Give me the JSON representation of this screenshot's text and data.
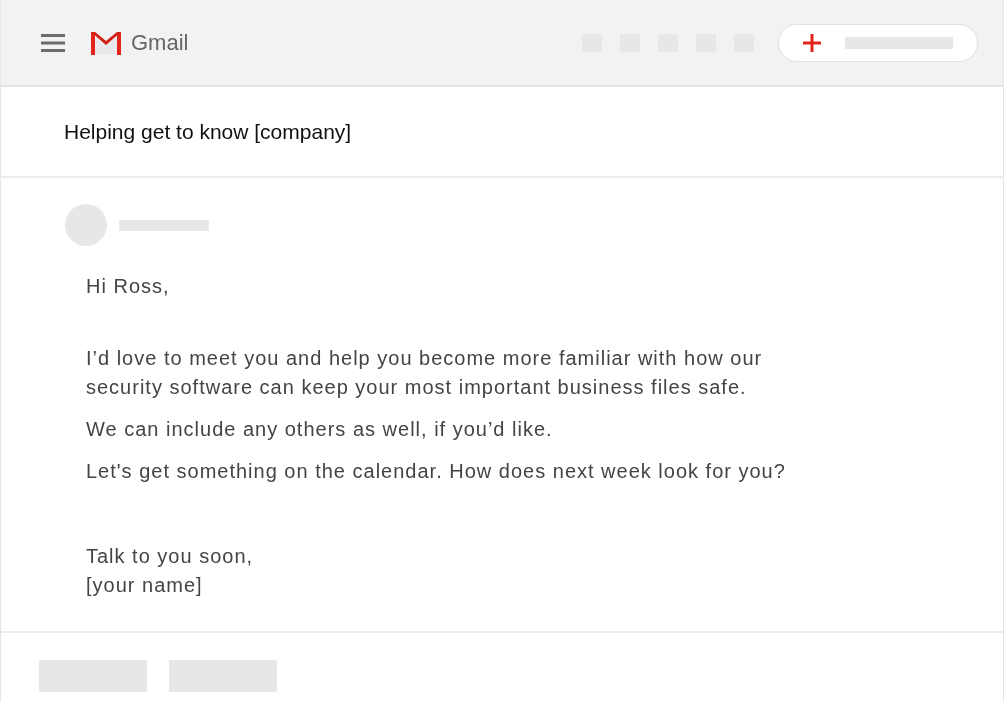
{
  "app": {
    "name": "Gmail"
  },
  "email": {
    "subject": "Helping get to know [company]",
    "paragraphs": [
      {
        "kind": "greeting",
        "lines": [
          "Hi Ross,"
        ]
      },
      {
        "kind": "body",
        "lines": [
          "I’d love to meet you and help you become more familiar with how our",
          "security software can keep your most important business files safe."
        ]
      },
      {
        "kind": "body",
        "lines": [
          "We can include any others as well, if you’d like."
        ]
      },
      {
        "kind": "body",
        "lines": [
          "Let's get something on the calendar. How does next week look for you?"
        ]
      },
      {
        "kind": "closing",
        "lines": [
          "Talk to you soon,",
          "[your name]"
        ]
      }
    ]
  }
}
